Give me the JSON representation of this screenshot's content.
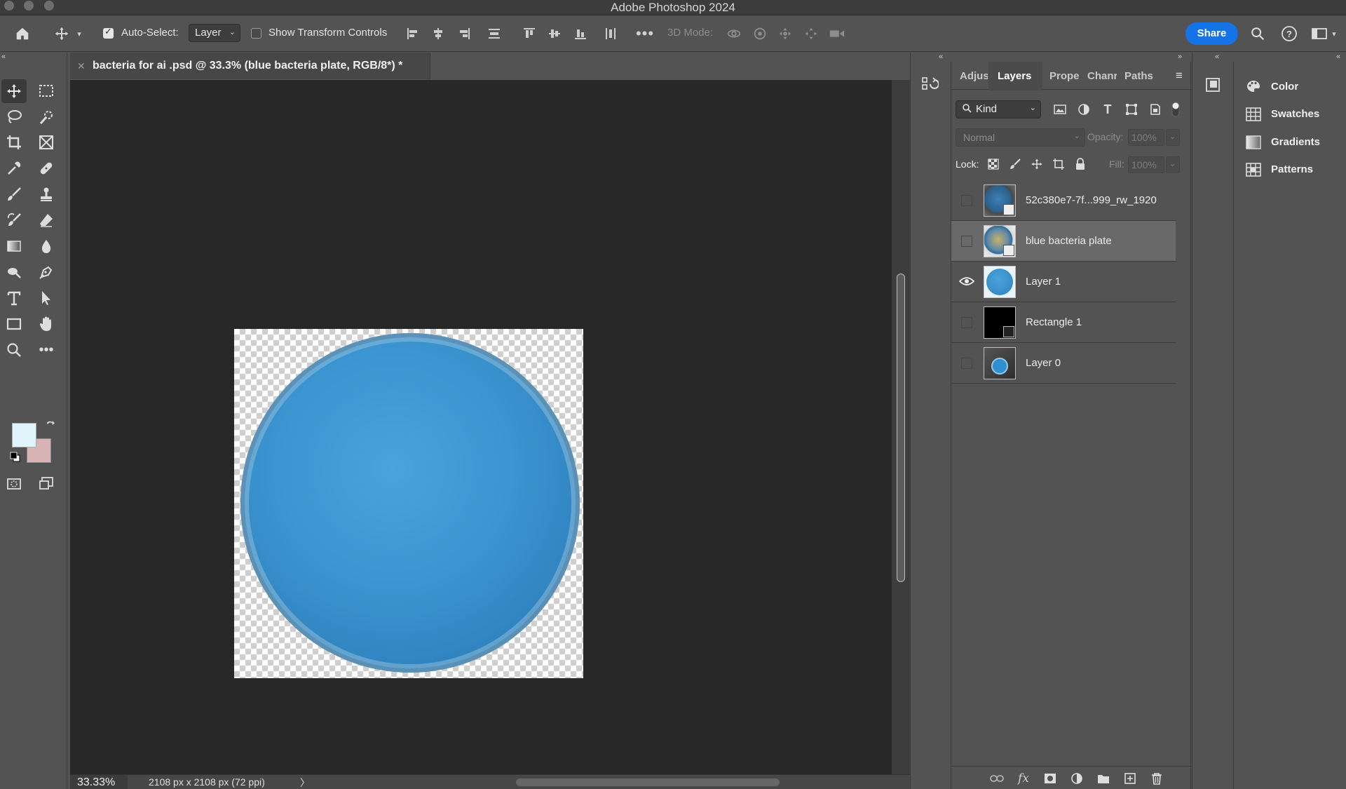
{
  "app": {
    "title": "Adobe Photoshop 2024"
  },
  "options_bar": {
    "auto_select_label": "Auto-Select:",
    "auto_select_target": "Layer",
    "transform_label": "Show Transform Controls",
    "three_d_label": "3D Mode:",
    "share_label": "Share"
  },
  "document": {
    "tab_title": "bacteria for ai .psd @ 33.3% (blue bacteria plate, RGB/8*) *",
    "zoom": "33.33%",
    "dimensions": "2108 px x 2108 px (72 ppi)",
    "status_arrow": "〉"
  },
  "colors": {
    "foreground": "#dff4fb",
    "background": "#d8b3b3",
    "accent": "#1473e6"
  },
  "panel_tabs": [
    "Adjus",
    "Layers",
    "Prope",
    "Chanr",
    "Paths"
  ],
  "layers_panel": {
    "filter_kind": "Kind",
    "blend_mode": "Normal",
    "opacity_label": "Opacity:",
    "opacity_value": "100%",
    "lock_label": "Lock:",
    "fill_label": "Fill:",
    "fill_value": "100%",
    "layers": [
      {
        "name": "52c380e7-7f...999_rw_1920",
        "visible": false,
        "selected": false,
        "thumb": "photo-plate",
        "smart": true
      },
      {
        "name": "blue bacteria plate",
        "visible": false,
        "selected": true,
        "thumb": "photo-plate-2",
        "smart": true
      },
      {
        "name": "Layer 1",
        "visible": true,
        "selected": false,
        "thumb": "blue-circle",
        "smart": false
      },
      {
        "name": "Rectangle 1",
        "visible": false,
        "selected": false,
        "thumb": "black",
        "smart": true
      },
      {
        "name": "Layer 0",
        "visible": false,
        "selected": false,
        "thumb": "dark-with-circle",
        "smart": false
      }
    ]
  },
  "right_panel": {
    "items": [
      {
        "label": "Color",
        "icon": "palette-icon"
      },
      {
        "label": "Swatches",
        "icon": "swatches-grid-icon"
      },
      {
        "label": "Gradients",
        "icon": "gradient-icon"
      },
      {
        "label": "Patterns",
        "icon": "patterns-grid-icon"
      }
    ]
  }
}
